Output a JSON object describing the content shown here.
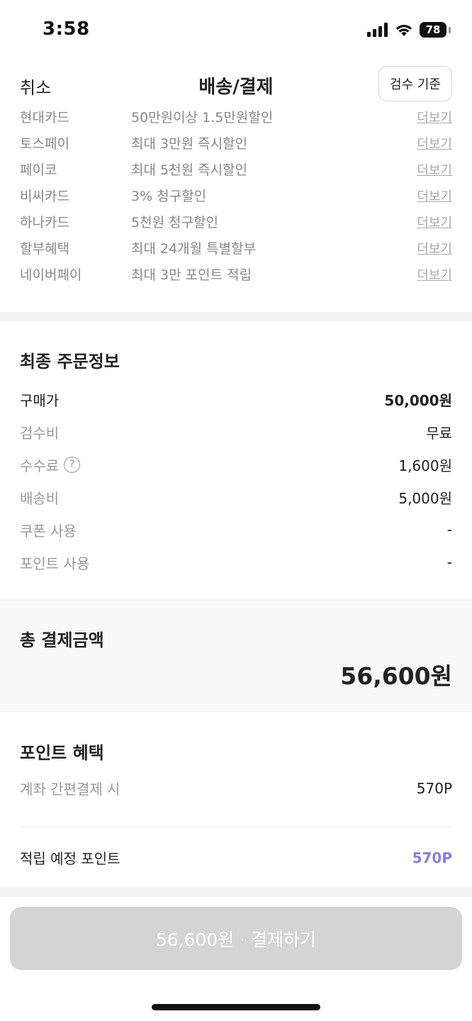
{
  "status_bar": {
    "time": "3:58",
    "battery": "78"
  },
  "nav": {
    "cancel": "취소",
    "title": "배송/결제",
    "criteria_button": "검수 기준"
  },
  "promos": [
    {
      "name": "현대카드",
      "desc": "50만원이상 1.5만원할인",
      "more": "더보기"
    },
    {
      "name": "토스페이",
      "desc": "최대 3만원 즉시할인",
      "more": "더보기"
    },
    {
      "name": "페이코",
      "desc": "최대 5천원 즉시할인",
      "more": "더보기"
    },
    {
      "name": "비씨카드",
      "desc": "3% 청구할인",
      "more": "더보기"
    },
    {
      "name": "하나카드",
      "desc": "5천원 청구할인",
      "more": "더보기"
    },
    {
      "name": "할부혜택",
      "desc": "최대 24개월 특별할부",
      "more": "더보기"
    },
    {
      "name": "네이버페이",
      "desc": "최대 3만 포인트 적립",
      "more": "더보기"
    }
  ],
  "order": {
    "title": "최종 주문정보",
    "rows": [
      {
        "label": "구매가",
        "value": "50,000원"
      },
      {
        "label": "검수비",
        "value": "무료"
      },
      {
        "label": "수수료",
        "value": "1,600원",
        "help_icon": "question-circle-icon",
        "help_glyph": "?"
      },
      {
        "label": "배송비",
        "value": "5,000원"
      },
      {
        "label": "쿠폰 사용",
        "value": "-"
      },
      {
        "label": "포인트 사용",
        "value": "-"
      }
    ]
  },
  "total": {
    "label": "총 결제금액",
    "amount": "56,600원"
  },
  "points": {
    "title": "포인트 혜택",
    "account_label": "계좌 간편결제 시",
    "account_value": "570P",
    "expected_label": "적립 예정 포인트",
    "expected_value": "570P"
  },
  "pay_button": "56,600원 · 결제하기",
  "colors": {
    "accent": "#8a7de0",
    "disabled_button": "#d4d4d4",
    "band": "#f1f1f1"
  }
}
